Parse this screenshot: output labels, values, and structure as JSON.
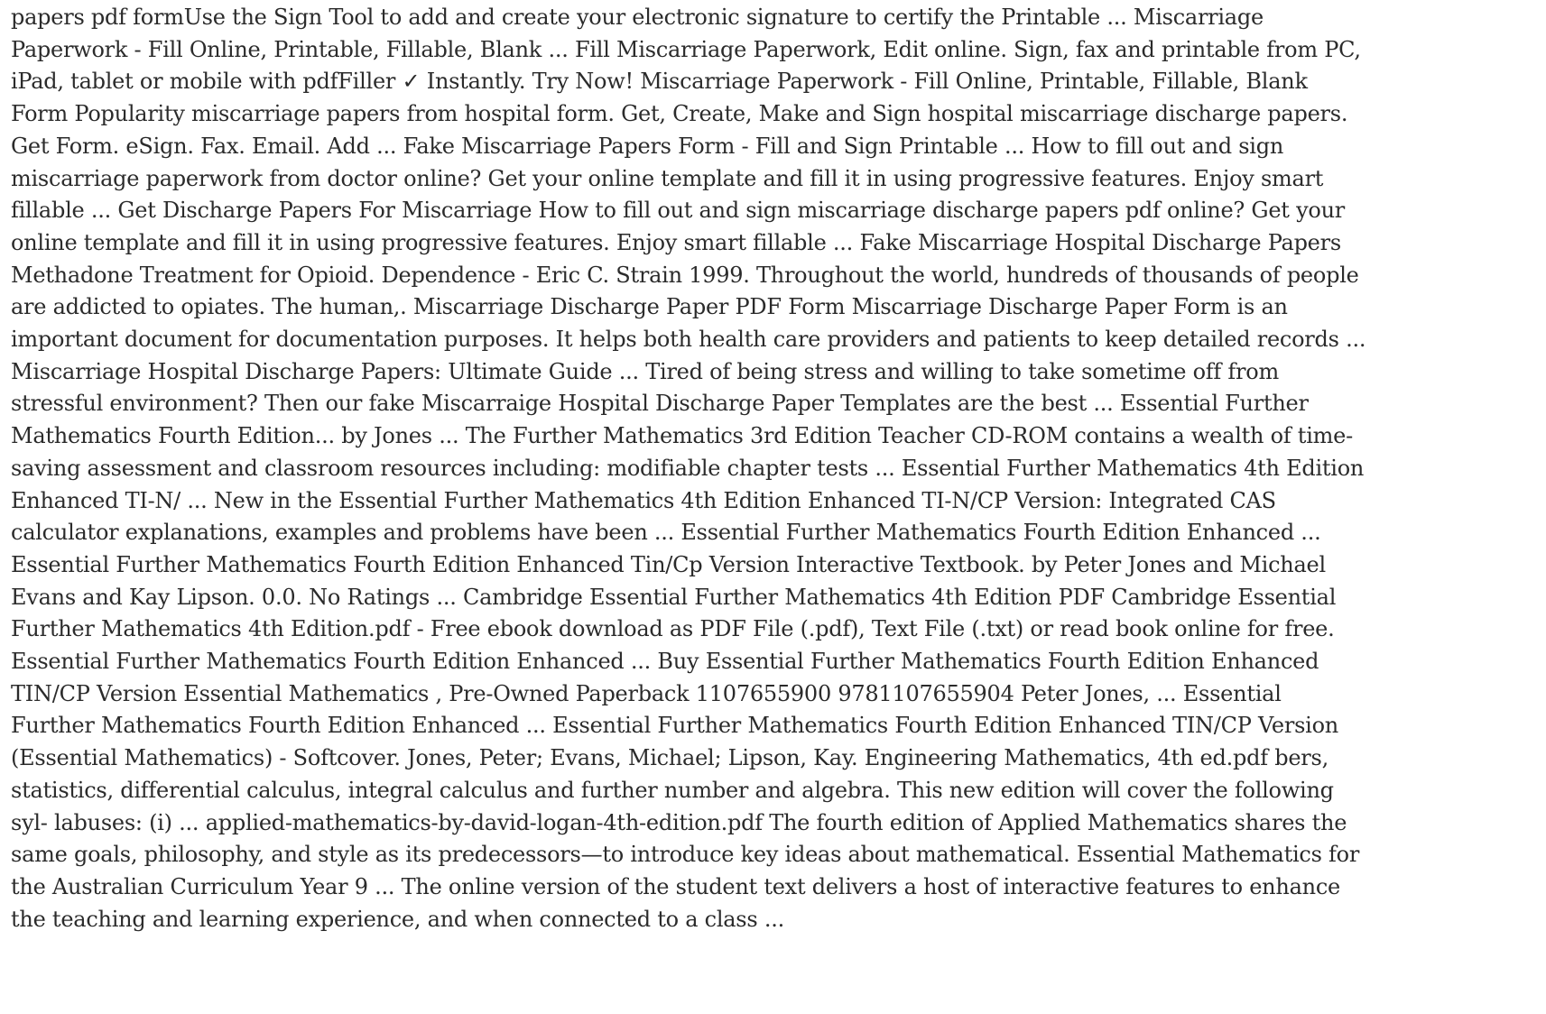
{
  "document": {
    "lines": [
      "papers pdf formUse the Sign Tool to add and create your electronic signature to certify the Printable ... Miscarriage",
      "Paperwork - Fill Online, Printable, Fillable, Blank ... Fill Miscarriage Paperwork, Edit online. Sign, fax and printable from PC,",
      "iPad, tablet or mobile with pdfFiller ✓ Instantly. Try Now! Miscarriage Paperwork - Fill Online, Printable, Fillable, Blank",
      "Form Popularity miscarriage papers from hospital form. Get, Create, Make and Sign hospital miscarriage discharge papers.",
      "Get Form. eSign. Fax. Email. Add ... Fake Miscarriage Papers Form - Fill and Sign Printable ... How to fill out and sign",
      "miscarriage paperwork from doctor online? Get your online template and fill it in using progressive features. Enjoy smart",
      "fillable ... Get Discharge Papers For Miscarriage How to fill out and sign miscarriage discharge papers pdf online? Get your",
      "online template and fill it in using progressive features. Enjoy smart fillable ... Fake Miscarriage Hospital Discharge Papers",
      "Methadone Treatment for Opioid. Dependence - Eric C. Strain 1999. Throughout the world, hundreds of thousands of people",
      "are addicted to opiates. The human,. Miscarriage Discharge Paper PDF Form Miscarriage Discharge Paper Form is an",
      "important document for documentation purposes. It helps both health care providers and patients to keep detailed records ...",
      "Miscarriage Hospital Discharge Papers: Ultimate Guide ... Tired of being stress and willing to take sometime off from",
      "stressful environment? Then our fake Miscarraige Hospital Discharge Paper Templates are the best ... Essential Further",
      "Mathematics Fourth Edition... by Jones ... The Further Mathematics 3rd Edition Teacher CD-ROM contains a wealth of time-",
      "saving assessment and classroom resources including: modifiable chapter tests ... Essential Further Mathematics 4th Edition",
      "Enhanced TI-N/ ... New in the Essential Further Mathematics 4th Edition Enhanced TI-N/CP Version: Integrated CAS",
      "calculator explanations, examples and problems have been ... Essential Further Mathematics Fourth Edition Enhanced ...",
      "Essential Further Mathematics Fourth Edition Enhanced Tin/Cp Version Interactive Textbook. by Peter Jones and Michael",
      "Evans and Kay Lipson. 0.0. No Ratings ... Cambridge Essential Further Mathematics 4th Edition PDF Cambridge Essential",
      "Further Mathematics 4th Edition.pdf - Free ebook download as PDF File (.pdf), Text File (.txt) or read book online for free.",
      "Essential Further Mathematics Fourth Edition Enhanced ... Buy Essential Further Mathematics Fourth Edition Enhanced",
      "TIN/CP Version Essential Mathematics , Pre-Owned Paperback 1107655900 9781107655904 Peter Jones, ... Essential",
      "Further Mathematics Fourth Edition Enhanced ... Essential Further Mathematics Fourth Edition Enhanced TIN/CP Version",
      "(Essential Mathematics) - Softcover. Jones, Peter; Evans, Michael; Lipson, Kay. Engineering Mathematics, 4th ed.pdf bers,",
      "statistics, differential calculus, integral calculus and further number and algebra. This new edition will cover the following",
      "syl- labuses: (i) ... applied-mathematics-by-david-logan-4th-edition.pdf The fourth edition of Applied Mathematics shares the",
      "same goals, philosophy, and style as its predecessors—to introduce key ideas about mathematical. Essential Mathematics for",
      "the Australian Curriculum Year 9 ... The online version of the student text delivers a host of interactive features to enhance",
      "the teaching and learning experience, and when connected to a class ..."
    ]
  }
}
